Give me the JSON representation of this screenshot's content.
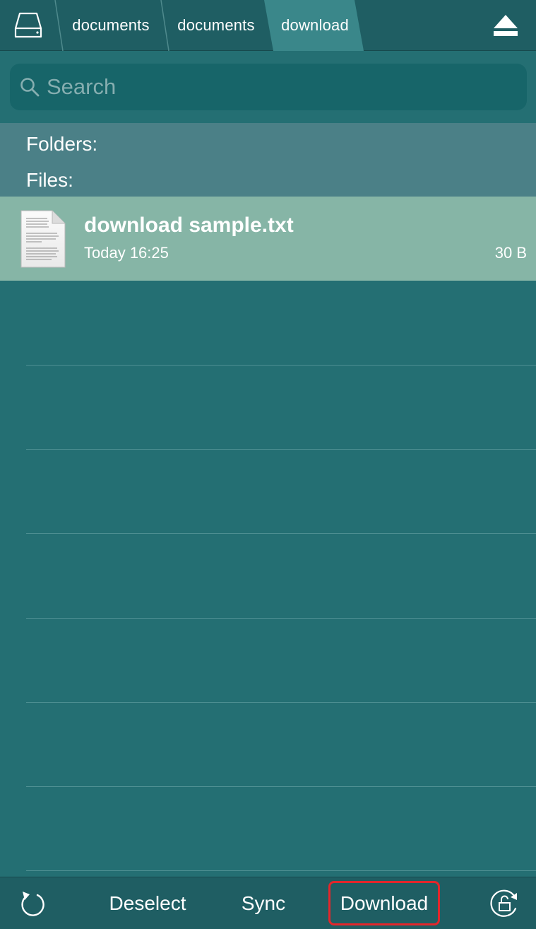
{
  "nav": {
    "drive_icon": "hard-drive-icon",
    "breadcrumbs": [
      {
        "label": "documents"
      },
      {
        "label": "documents"
      },
      {
        "label": "download"
      }
    ],
    "eject_icon": "eject-icon"
  },
  "search": {
    "placeholder": "Search",
    "value": "",
    "icon": "search-icon"
  },
  "sections": {
    "folders_label": "Folders:",
    "files_label": "Files:"
  },
  "files": [
    {
      "name": "download sample.txt",
      "date": "Today 16:25",
      "size": "30 B",
      "icon": "text-document-icon"
    }
  ],
  "toolbar": {
    "refresh_icon": "refresh-icon",
    "deselect_label": "Deselect",
    "sync_label": "Sync",
    "download_label": "Download",
    "lock_icon": "lock-rotate-icon"
  },
  "colors": {
    "background": "#246f73",
    "bar": "#1f5e63",
    "section_header": "#4b8087",
    "selected_row": "#86b5a6",
    "active_crumb": "#3a878a",
    "highlight": "#e3262b"
  }
}
